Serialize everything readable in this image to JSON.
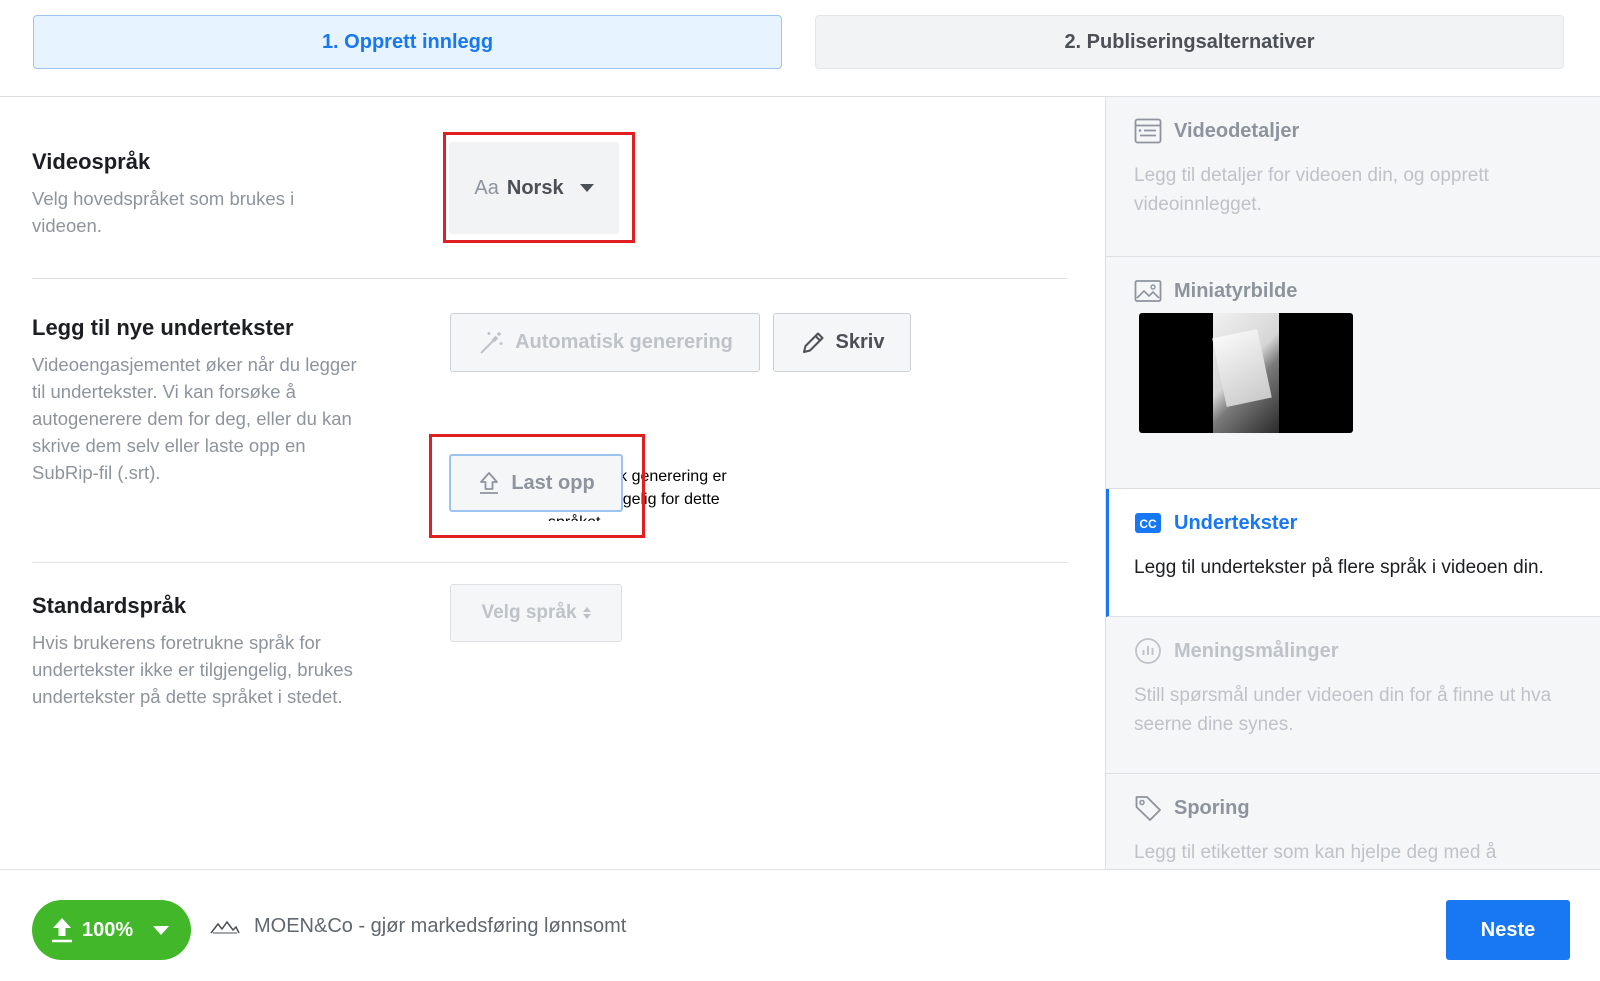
{
  "steps": {
    "step1": "1. Opprett innlegg",
    "step2": "2. Publiseringsalternativer"
  },
  "video_language": {
    "title": "Videospråk",
    "description": "Velg hovedspråket som brukes i videoen.",
    "select_prefix": "Aa",
    "select_value": "Norsk"
  },
  "add_subtitles": {
    "title": "Legg til nye undertekster",
    "description": "Videoengasjementet øker når du legger til undertekster. Vi kan forsøke å autogenerere dem for deg, eller du kan skrive dem selv eller laste opp en SubRip-fil (.srt).",
    "auto_button": "Automatisk generering",
    "write_button": "Skriv",
    "warning": "Automatisk generering er ikke tilgjengelig for dette språket.",
    "upload_button": "Last opp"
  },
  "default_language": {
    "title": "Standardspråk",
    "description": "Hvis brukerens foretrukne språk for undertekster ikke er tilgjengelig, brukes undertekster på dette språket i stedet.",
    "select_placeholder": "Velg språk"
  },
  "sidebar": {
    "video_details": {
      "title": "Videodetaljer",
      "description": "Legg til detaljer for videoen din, og opprett videoinnlegget."
    },
    "thumbnail": {
      "title": "Miniatyrbilde"
    },
    "subtitles": {
      "title": "Undertekster",
      "description": "Legg til undertekster på flere språk i videoen din."
    },
    "polls": {
      "title": "Meningsmålinger",
      "description": "Still spørsmål under videoen din for å finne ut hva seerne dine synes."
    },
    "tracking": {
      "title": "Sporing",
      "description": "Legg til etiketter som kan hjelpe deg med å"
    }
  },
  "footer": {
    "progress": "100%",
    "page_name": "MOEN&Co - gjør markedsføring lønnsomt",
    "next_button": "Neste"
  },
  "colors": {
    "accent": "#1877f2",
    "success": "#42b72a",
    "highlight": "#e02020"
  }
}
